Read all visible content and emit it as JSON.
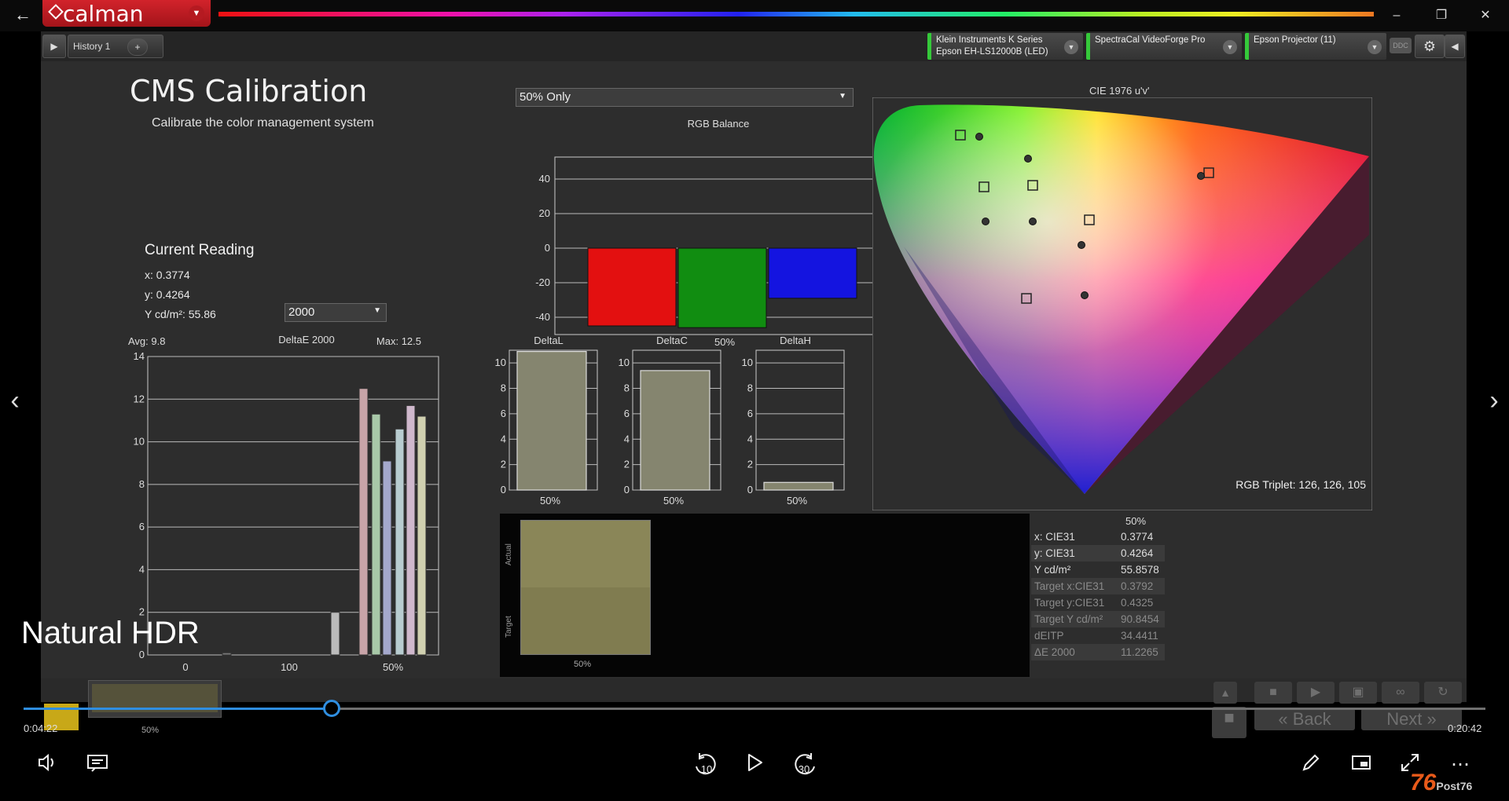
{
  "app": {
    "logo_text": "calman",
    "tab_label": "History 1",
    "tab_add": "+",
    "devices": [
      {
        "line1": "Klein Instruments K Series",
        "line2": "Epson EH-LS12000B (LED)"
      },
      {
        "line1": "SpectraCal VideoForge Pro",
        "line2": ""
      },
      {
        "line1": "Epson Projector (11)",
        "line2": ""
      }
    ],
    "ddc_label": "DDC"
  },
  "page": {
    "title": "CMS Calibration",
    "subtitle": "Calibrate the color management system",
    "mode_select": "50% Only"
  },
  "reading": {
    "title": "Current Reading",
    "x": "x: 0.3774",
    "y": "y: 0.4264",
    "Y": "Y cd/m²: 55.86",
    "de_select": "2000"
  },
  "deltae_chart": {
    "title": "DeltaE 2000",
    "avg": "Avg: 9.8",
    "max": "Max: 12.5",
    "yticks": [
      "0",
      "2",
      "4",
      "6",
      "8",
      "10",
      "12",
      "14"
    ],
    "xticks": [
      "0",
      "100",
      "50%"
    ],
    "bars": [
      0.1,
      2.0,
      12.5,
      11.3,
      9.1,
      10.6,
      11.7,
      11.2
    ],
    "bar_colors": [
      "#777777",
      "#bbbbbb",
      "#c8a4a8",
      "#a8c8a8",
      "#a4a8cc",
      "#b8ccd0",
      "#cfb8cc",
      "#d0d0b0"
    ]
  },
  "rgb_balance": {
    "title": "RGB Balance",
    "yticks": [
      "40",
      "20",
      "0",
      "-20",
      "-40"
    ],
    "xlabel": "50%",
    "values": {
      "red": -45,
      "green": -46,
      "blue": -29
    }
  },
  "delta_l": {
    "title": "DeltaL",
    "value": 10.9,
    "xlabel": "50%"
  },
  "delta_c": {
    "title": "DeltaC",
    "value": 9.4,
    "xlabel": "50%"
  },
  "delta_h": {
    "title": "DeltaH",
    "value": 0.6,
    "xlabel": "50%"
  },
  "delta_yticks": [
    "10",
    "8",
    "6",
    "4",
    "2",
    "0"
  ],
  "cie": {
    "title": "CIE 1976 u'v'",
    "triplet": "RGB Triplet: 126, 126, 105"
  },
  "swatch": {
    "actual": "Actual",
    "target": "Target",
    "label": "50%"
  },
  "table": {
    "header": "50%",
    "rows": [
      {
        "k": "x: CIE31",
        "v": "0.3774"
      },
      {
        "k": "y: CIE31",
        "v": "0.4264"
      },
      {
        "k": "Y cd/m²",
        "v": "55.8578"
      },
      {
        "k": "Target x:CIE31",
        "v": "0.3792"
      },
      {
        "k": "Target y:CIE31",
        "v": "0.4325"
      },
      {
        "k": "Target Y cd/m²",
        "v": "90.8454"
      },
      {
        "k": "dEITP",
        "v": "34.4411"
      },
      {
        "k": "ΔE 2000",
        "v": "11.2265"
      }
    ]
  },
  "bottom": {
    "thumb_label": "50%",
    "back": "Back",
    "next": "Next"
  },
  "player": {
    "overlay_title": "Natural HDR",
    "elapsed": "0:04:22",
    "total": "0:20:42",
    "progress": 0.211,
    "skip_back": "10",
    "skip_fwd": "30"
  },
  "watermark": {
    "big": "76",
    "small": "Post76"
  },
  "colors": {
    "accent": "#2f8ee0",
    "calman_red": "#d2232b",
    "device_green": "#35c93a"
  }
}
